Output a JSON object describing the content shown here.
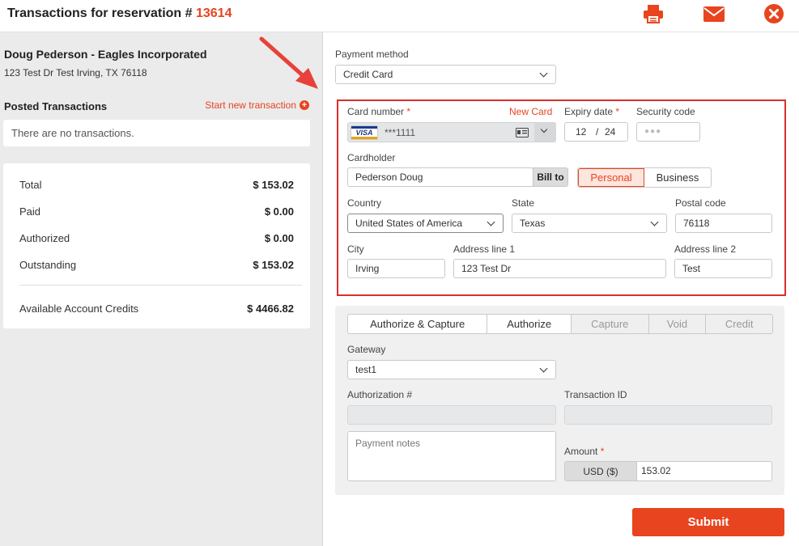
{
  "header": {
    "title_prefix": "Transactions for reservation # ",
    "reservation_number": "13614",
    "icons": [
      "printer-icon",
      "envelope-icon",
      "close-icon"
    ]
  },
  "guest": {
    "name": "Doug Pederson - Eagles Incorporated",
    "address": "123 Test Dr Test Irving, TX 76118"
  },
  "posted": {
    "title": "Posted Transactions",
    "start_new": "Start new transaction",
    "empty_message": "There are no transactions."
  },
  "totals": [
    {
      "label": "Total",
      "value": "$ 153.02"
    },
    {
      "label": "Paid",
      "value": "$ 0.00"
    },
    {
      "label": "Authorized",
      "value": "$ 0.00"
    },
    {
      "label": "Outstanding",
      "value": "$ 153.02"
    },
    {
      "label": "Available Account Credits",
      "value": "$ 4466.82"
    }
  ],
  "payment": {
    "method_label": "Payment method",
    "method_value": "Credit Card"
  },
  "card": {
    "number_label": "Card number",
    "required_mark": "*",
    "new_card": "New Card",
    "brand": "VISA",
    "masked_number": "***1111",
    "expiry_label": "Expiry date",
    "expiry_month": "12",
    "expiry_sep": "/",
    "expiry_year": "24",
    "security_label": "Security code",
    "security_placeholder": "●●●",
    "cardholder_label": "Cardholder",
    "cardholder_value": "Pederson Doug",
    "bill_to": "Bill to",
    "personal": "Personal",
    "business": "Business",
    "country_label": "Country",
    "country_value": "United States of America",
    "state_label": "State",
    "state_value": "Texas",
    "postal_label": "Postal code",
    "postal_value": "76118",
    "city_label": "City",
    "city_value": "Irving",
    "address1_label": "Address line 1",
    "address1_value": "123 Test Dr",
    "address2_label": "Address line 2",
    "address2_value": "Test"
  },
  "actions": {
    "tabs": [
      {
        "label": "Authorize & Capture",
        "enabled": true
      },
      {
        "label": "Authorize",
        "enabled": true
      },
      {
        "label": "Capture",
        "enabled": false
      },
      {
        "label": "Void",
        "enabled": false
      },
      {
        "label": "Credit",
        "enabled": false
      }
    ],
    "gateway_label": "Gateway",
    "gateway_value": "test1",
    "auth_label": "Authorization #",
    "txn_label": "Transaction ID",
    "notes_placeholder": "Payment notes",
    "amount_label": "Amount",
    "currency": "USD ($)",
    "amount_value": "153.02"
  },
  "submit_label": "Submit",
  "colors": {
    "accent": "#e8441f",
    "highlight_border": "#d9302c"
  }
}
